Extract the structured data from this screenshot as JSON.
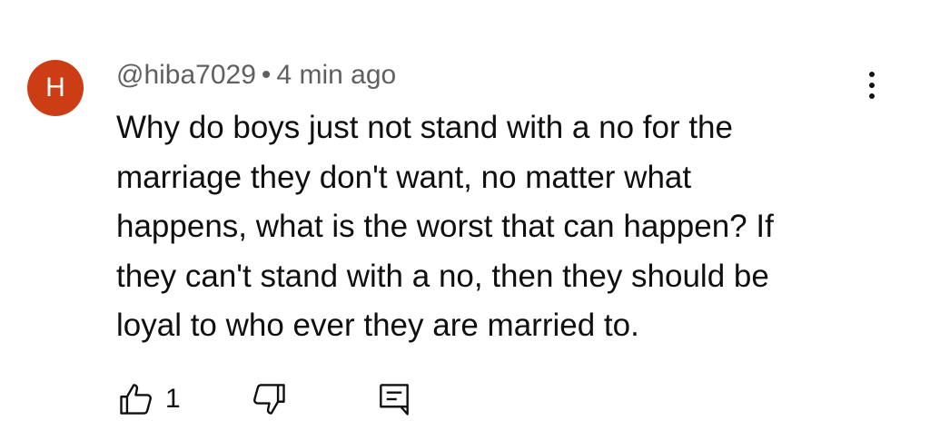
{
  "comment": {
    "avatar_letter": "H",
    "avatar_color": "#cc3d16",
    "author": "@hiba7029",
    "separator": "•",
    "time_ago": "4 min ago",
    "text_lines": [
      "Why do boys just not stand with a no for the",
      "marriage they don't want, no matter what",
      "happens, what is the worst that can happen? If",
      "they can't stand with a no, then they should be",
      "loyal to who ever they are married to."
    ],
    "like_count": "1",
    "icons": {
      "like": "thumbs-up-icon",
      "dislike": "thumbs-down-icon",
      "reply": "reply-comment-icon",
      "menu": "more-vert-icon"
    }
  }
}
